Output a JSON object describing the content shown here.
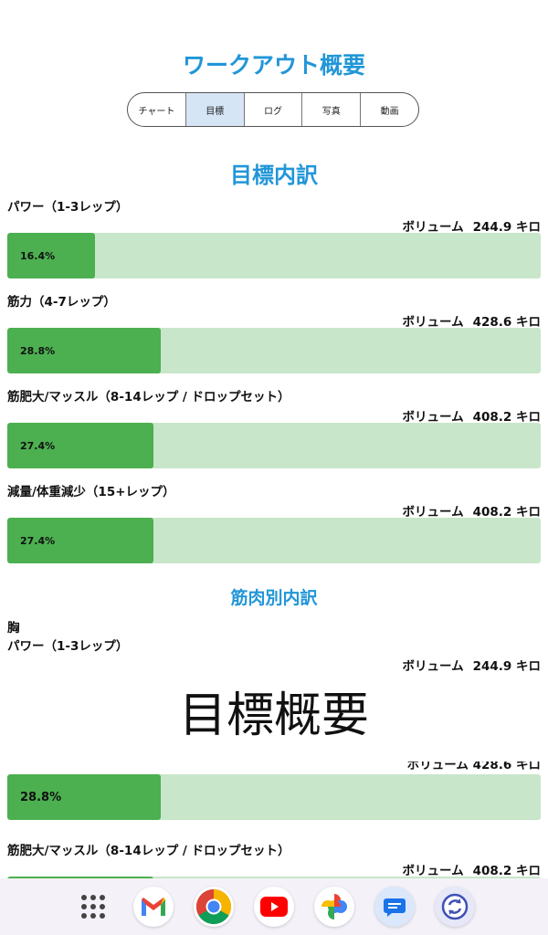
{
  "header": {
    "title": "ワークアウト概要"
  },
  "tabs": [
    {
      "label": "チャート",
      "active": false
    },
    {
      "label": "目標",
      "active": true
    },
    {
      "label": "ログ",
      "active": false
    },
    {
      "label": "写真",
      "active": false
    },
    {
      "label": "動画",
      "active": false
    }
  ],
  "goal_breakdown": {
    "title": "目標内訳",
    "items": [
      {
        "label": "パワー（1-3レップ）",
        "volume_label": "ボリューム",
        "volume": "244.9 キロ",
        "percent": 16.4,
        "percent_text": "16.4%"
      },
      {
        "label": "筋力（4-7レップ）",
        "volume_label": "ボリューム",
        "volume": "428.6 キロ",
        "percent": 28.8,
        "percent_text": "28.8%"
      },
      {
        "label": "筋肥大/マッスル（8-14レップ / ドロップセット）",
        "volume_label": "ボリューム",
        "volume": "408.2 キロ",
        "percent": 27.4,
        "percent_text": "27.4%"
      },
      {
        "label": "減量/体重減少（15+レップ）",
        "volume_label": "ボリューム",
        "volume": "408.2 キロ",
        "percent": 27.4,
        "percent_text": "27.4%"
      }
    ]
  },
  "muscle_breakdown": {
    "title": "筋肉別内訳",
    "group": "胸",
    "items": [
      {
        "label": "パワー（1-3レップ）",
        "volume_label": "ボリューム",
        "volume": "244.9 キロ"
      },
      {
        "percent": 28.8,
        "percent_text": "28.8%"
      },
      {
        "label": "筋肥大/マッスル（8-14レップ / ドロップセット）",
        "volume_label": "ボリューム",
        "volume": "408.2 キロ"
      }
    ]
  },
  "toast": {
    "text": "目標概要"
  },
  "dock": {
    "icons": [
      "app-grid-icon",
      "gmail-icon",
      "chrome-icon",
      "youtube-icon",
      "photos-icon",
      "messages-icon",
      "sync-app-icon"
    ]
  },
  "colors": {
    "accent": "#2196d8",
    "bar_fill": "#4caf50",
    "bar_track": "#c8e6c9",
    "active_tab": "#d5e5f5"
  }
}
